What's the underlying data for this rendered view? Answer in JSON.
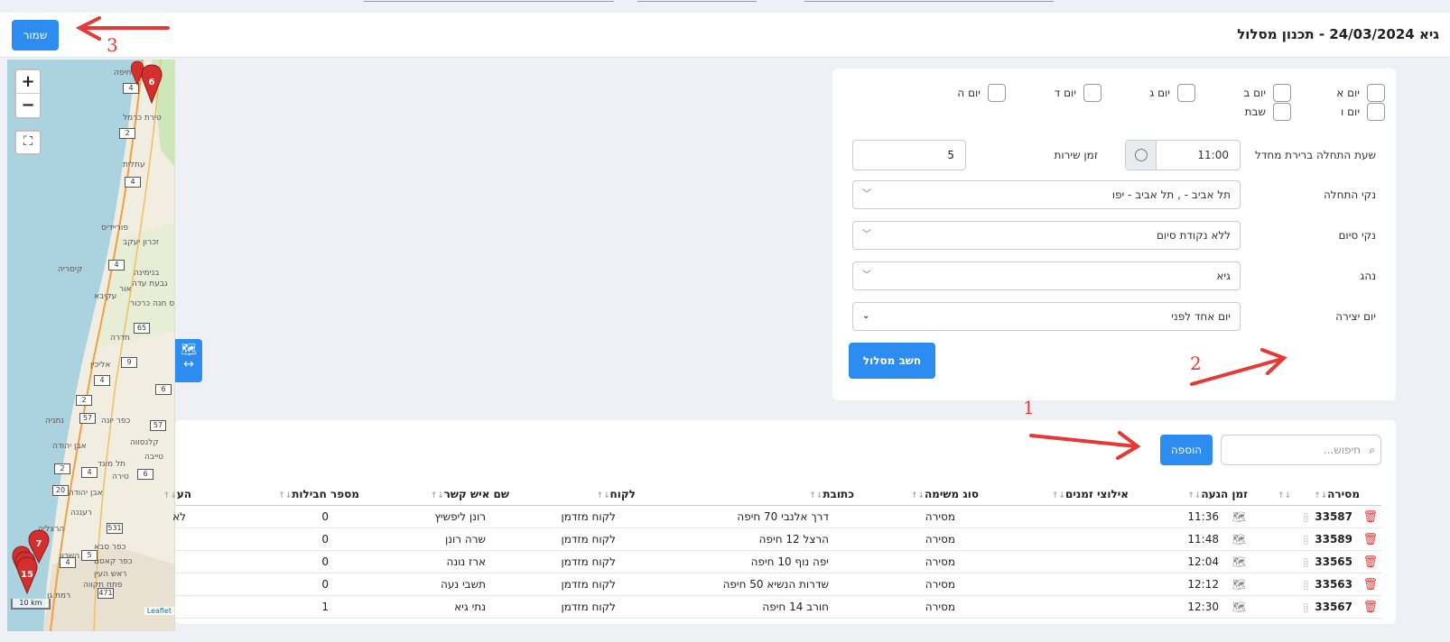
{
  "header": {
    "title": "גיא 24/03/2024 - תכנון מסלול",
    "save_label": "שמור"
  },
  "annotations": [
    "1",
    "2",
    "3"
  ],
  "map": {
    "zoom_in": "+",
    "zoom_out": "−",
    "scale": "10 km",
    "attribution": "Leaflet",
    "labels": [
      "חיפה",
      "טירת כרמל",
      "עתלית",
      "פוריידיס",
      "זכרון יעקב",
      "קיסריה",
      "בנימינה",
      "גבעת עדה",
      "עקיבא",
      "אור",
      "פרדס חנה כרכור",
      "חדרה",
      "אליכין",
      "כפר יונה",
      "נתניה",
      "קלנסווה",
      "טייבה",
      "אבן יהודה",
      "כפר סבא",
      "רעננה",
      "הרצליה",
      "רמת השרון",
      "ראש העין",
      "פתח תקווה",
      "רמת גן",
      "תל מונד",
      "כפר קאסם",
      "טירה",
      "אבן יהודה"
    ],
    "roads": [
      "4",
      "2",
      "4",
      "4",
      "65",
      "9",
      "4",
      "6",
      "2",
      "57",
      "57",
      "2",
      "4",
      "6",
      "20",
      "531",
      "5",
      "4",
      "471"
    ],
    "marker_labels": [
      "6",
      "7",
      "15"
    ]
  },
  "form": {
    "days": [
      {
        "label": "יום א"
      },
      {
        "label": "יום ב"
      },
      {
        "label": "יום ג"
      },
      {
        "label": "יום ד"
      },
      {
        "label": "יום ה"
      },
      {
        "label": "יום ו"
      },
      {
        "label": "שבת"
      }
    ],
    "start_time_label": "שעת התחלה ברירת מחדל",
    "start_time_value": "11:00",
    "service_time_label": "זמן שירות",
    "service_time_value": "5",
    "start_point_label": "נקי התחלה",
    "start_point_value": "תל אביב - , תל אביב - יפו",
    "end_point_label": "נקי סיום",
    "end_point_value": "ללא נקודת סיום",
    "driver_label": "נהג",
    "driver_value": "גיא",
    "creation_day_label": "יום יצירה",
    "creation_day_value": "יום אחד לפני",
    "calc_label": "חשב מסלול"
  },
  "table": {
    "search_placeholder": "חיפוש...",
    "add_label": "הוספה",
    "headers": {
      "delivery": "מסירה",
      "arrival": "זמן הגעה",
      "time_constraints": "אילוצי זמנים",
      "task_type": "סוג משימה",
      "address": "כתובת",
      "customer": "לקוח",
      "contact": "שם איש קשר",
      "packages": "מספר חבילות",
      "extra": "הע"
    },
    "rows": [
      {
        "id": "33587",
        "time": "11:36",
        "type": "מסירה",
        "address": "דרך אלנבי 70 חיפה",
        "customer": "לקוח מזדמן",
        "contact": "רונן ליפשיץ",
        "packages": "0",
        "extra": "לא"
      },
      {
        "id": "33589",
        "time": "11:48",
        "type": "מסירה",
        "address": "הרצל 12 חיפה",
        "customer": "לקוח מזדמן",
        "contact": "שרה רונן",
        "packages": "0",
        "extra": ""
      },
      {
        "id": "33565",
        "time": "12:04",
        "type": "מסירה",
        "address": "יפה נוף 10 חיפה",
        "customer": "לקוח מזדמן",
        "contact": "ארז נונה",
        "packages": "0",
        "extra": ""
      },
      {
        "id": "33563",
        "time": "12:12",
        "type": "מסירה",
        "address": "שדרות הנשיא 50 חיפה",
        "customer": "לקוח מזדמן",
        "contact": "תשבי נעה",
        "packages": "0",
        "extra": ""
      },
      {
        "id": "33567",
        "time": "12:30",
        "type": "מסירה",
        "address": "חורב 14 חיפה",
        "customer": "לקוח מזדמן",
        "contact": "נתי גיא",
        "packages": "1",
        "extra": ""
      }
    ]
  },
  "colors": {
    "accent": "#2d8cf0",
    "annotation": "#e53935",
    "marker": "#d32f2f"
  }
}
